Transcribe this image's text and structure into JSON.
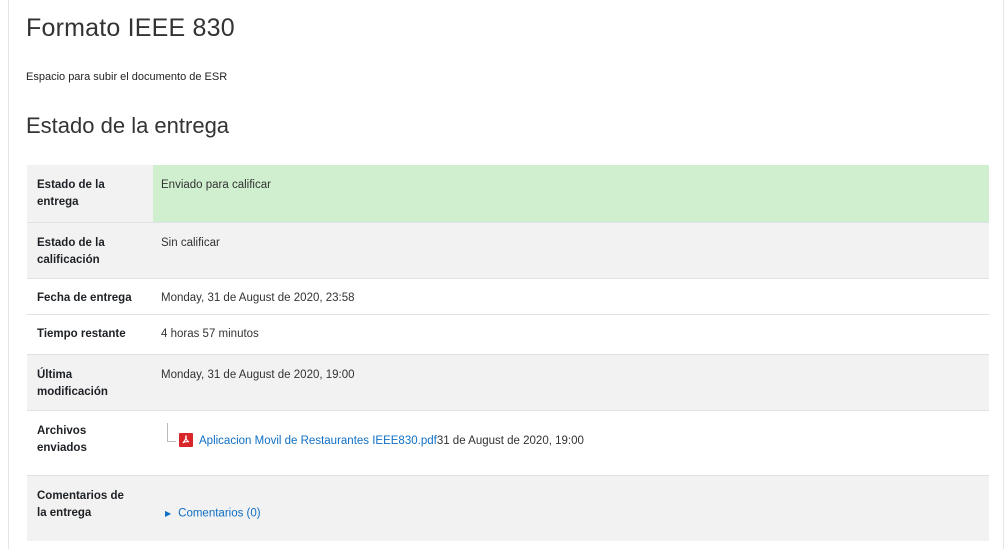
{
  "assignment": {
    "title": "Formato IEEE 830",
    "description": "Espacio para subir el documento de ESR"
  },
  "section_title": "Estado de la entrega",
  "rows": [
    {
      "label_l1": "Estado de la",
      "label_l2": "entrega",
      "value": "Enviado para calificar"
    },
    {
      "label_l1": "Estado de la",
      "label_l2": "calificación",
      "value": "Sin calificar"
    },
    {
      "label": "Fecha de entrega",
      "value": "Monday, 31 de August de 2020, 23:58"
    },
    {
      "label": "Tiempo restante",
      "value": "4 horas 57 minutos"
    },
    {
      "label_l1": "Última",
      "label_l2": "modificación",
      "value": "Monday, 31 de August de 2020, 19:00"
    },
    {
      "label_l1": "Archivos",
      "label_l2": "enviados",
      "file_name": "Aplicacion Movil de Restaurantes IEEE830.pdf",
      "file_date": "31 de August de 2020, 19:00"
    },
    {
      "label_l1": "Comentarios de",
      "label_l2": "la entrega",
      "comments_link": "Comentarios (0)"
    }
  ],
  "colors": {
    "submitted_bg": "#cfefcf",
    "link": "#0f6fc5",
    "row_gray": "#f2f2f2"
  },
  "icons": {
    "file_type": "pdf-icon",
    "expand": "caret-right-icon"
  }
}
